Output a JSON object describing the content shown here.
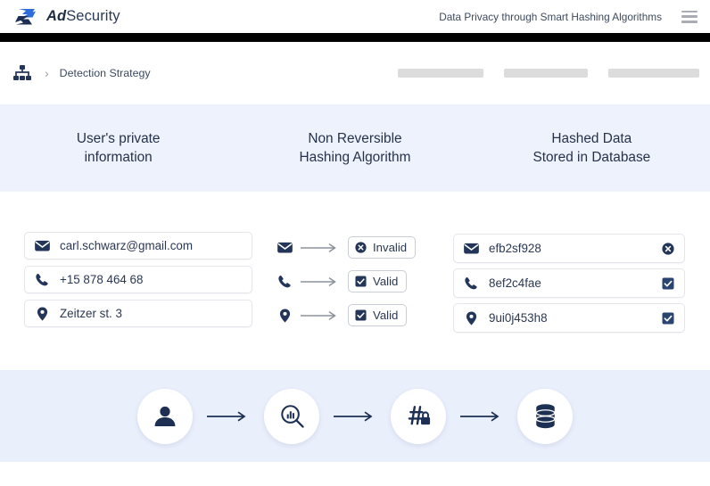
{
  "header": {
    "logo_icon": "adsecurity-s-logo",
    "brand_bold": "Ad",
    "brand_rest": "Security",
    "tagline": "Data Privacy through Smart Hashing Algorithms",
    "menu_icon": "hamburger-menu-icon"
  },
  "breadcrumb": {
    "root_icon": "sitemap-icon",
    "separator": "›",
    "label": "Detection Strategy",
    "skeleton_count": 3
  },
  "columns": {
    "left_title_line1": "User's private",
    "left_title_line2": "information",
    "mid_title_line1": "Non Reversible",
    "mid_title_line2": "Hashing Algorithm",
    "right_title_line1": "Hashed Data",
    "right_title_line2": "Stored in Database"
  },
  "rows": [
    {
      "icon": "envelope-icon",
      "private_value": "carl.schwarz@gmail.com",
      "status_label": "Invalid",
      "status_icon": "circle-x-icon",
      "status_valid": false,
      "hash_value": "efb2sf928",
      "hash_status_icon": "circle-x-icon"
    },
    {
      "icon": "phone-icon",
      "private_value": "+15 878 464 68",
      "status_label": "Valid",
      "status_icon": "checkbox-checked-icon",
      "status_valid": true,
      "hash_value": "8ef2c4fae",
      "hash_status_icon": "checkbox-checked-icon"
    },
    {
      "icon": "location-pin-icon",
      "private_value": "Zeitzer st. 3",
      "status_label": "Valid",
      "status_icon": "checkbox-checked-icon",
      "status_valid": true,
      "hash_value": "9ui0j453h8",
      "hash_status_icon": "checkbox-checked-icon"
    }
  ],
  "flow": {
    "steps": [
      {
        "icon": "user-person-icon"
      },
      {
        "icon": "magnifier-chart-icon"
      },
      {
        "icon": "hash-lock-icon"
      },
      {
        "icon": "database-icon"
      }
    ],
    "arrow_icon": "arrow-right-icon"
  },
  "colors": {
    "navy": "#1f3254",
    "brand_blue": "#2563c9",
    "band_light": "#eef2fc",
    "band_flow": "#eaeffc",
    "black_bar": "#000000",
    "skeleton_grey": "#dcdcdc",
    "border": "#e3e6eb"
  }
}
